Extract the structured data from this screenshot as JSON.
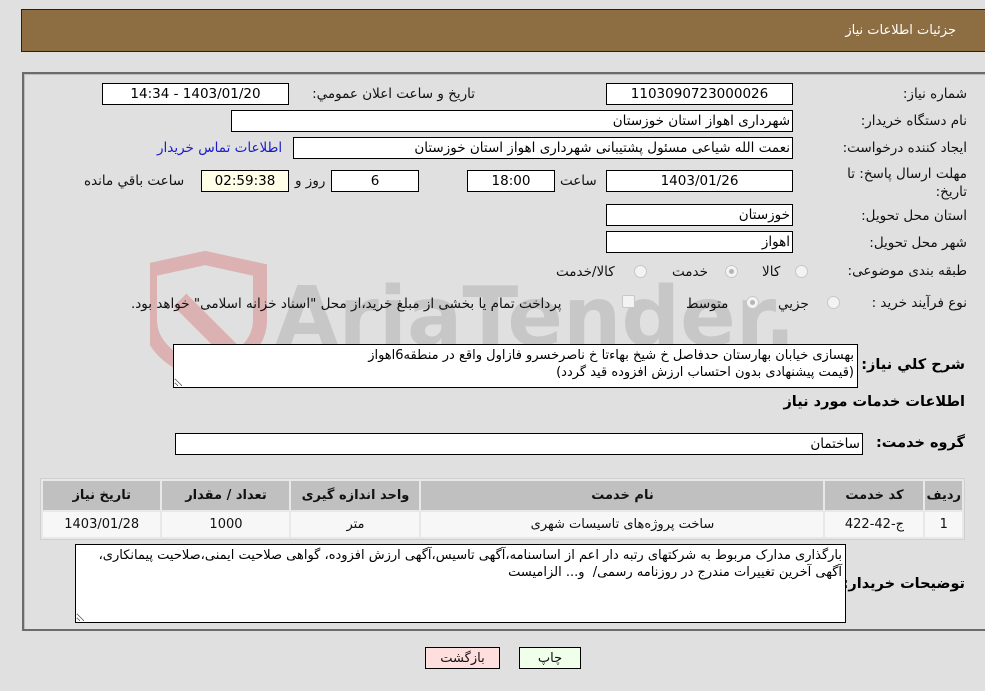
{
  "header": {
    "title": "جزئیات اطلاعات نیاز"
  },
  "form": {
    "need_number": {
      "label": "شماره نیاز:",
      "value": "1103090723000026"
    },
    "announce_datetime": {
      "label": "تاریخ و ساعت اعلان عمومي:",
      "value": "1403/01/20 - 14:34"
    },
    "buyer_org": {
      "label": "نام دستگاه خریدار:",
      "value": "شهرداری اهواز استان خوزستان"
    },
    "requester": {
      "label": "ایجاد کننده درخواست:",
      "value": "نعمت الله شیاعی مسئول پشتیبانی شهرداری اهواز استان خوزستان"
    },
    "buyer_contact_link": "اطلاعات تماس خریدار",
    "deadline": {
      "label": "مهلت ارسال پاسخ: تا تاریخ:",
      "date": "1403/01/26",
      "time_label": "ساعت",
      "time": "18:00",
      "days": "6",
      "days_label": "روز و",
      "remaining": "02:59:38",
      "remaining_label": "ساعت باقي مانده"
    },
    "delivery_province": {
      "label": "استان محل تحویل:",
      "value": "خوزستان"
    },
    "delivery_city": {
      "label": "شهر محل تحویل:",
      "value": "اهواز"
    },
    "category": {
      "label": "طبقه بندی موضوعی:",
      "options": [
        "کالا",
        "خدمت",
        "کالا/خدمت"
      ],
      "selected": "خدمت"
    },
    "purchase_type": {
      "label": "نوع فرآیند خرید :",
      "options": [
        "جزيي",
        "متوسط"
      ],
      "selected": "متوسط",
      "treasury_note": "پرداخت تمام یا بخشی از مبلغ خرید،از محل \"اسناد خزانه اسلامی\" خواهد بود."
    },
    "description": {
      "label": "شرح کلي نياز:",
      "value": "بهسازی خیابان بهارستان حدفاصل خ شیخ بهاءتا خ ناصرخسرو فازاول واقع در منطقه6اهواز\n(قیمت پیشنهادی بدون احتساب ارزش افزوده قید گردد)"
    },
    "services_section_title": "اطلاعات خدمات مورد نیاز",
    "service_group": {
      "label": "گروه خدمت:",
      "value": "ساختمان"
    }
  },
  "table": {
    "headers": [
      "ردیف",
      "کد خدمت",
      "نام خدمت",
      "واحد اندازه گیری",
      "تعداد / مقدار",
      "تاریخ نیاز"
    ],
    "rows": [
      [
        "1",
        "ج-42-422",
        "ساخت پروژه‌های تاسیسات شهری",
        "متر",
        "1000",
        "1403/01/28"
      ]
    ]
  },
  "buyer_notes": {
    "label": "توضیحات خریدار:",
    "value": "بارگذاری مدارک مربوط به شرکتهای رتبه دار اعم از اساسنامه،آگهی تاسیس،آگهی ارزش افزوده، گواهی صلاحیت ایمنی،صلاحیت پیمانکاری، آگهی آخرین تغییرات مندرج در روزنامه رسمی/  و... الزامیست"
  },
  "buttons": {
    "print": "چاپ",
    "back": "بازگشت"
  },
  "colors": {
    "header_bg": "#8d6d42",
    "print_bg": "#efffea",
    "back_bg": "#ffdede",
    "link": "#1a1acc"
  },
  "watermark": {
    "text": "AriaTender.neT"
  }
}
